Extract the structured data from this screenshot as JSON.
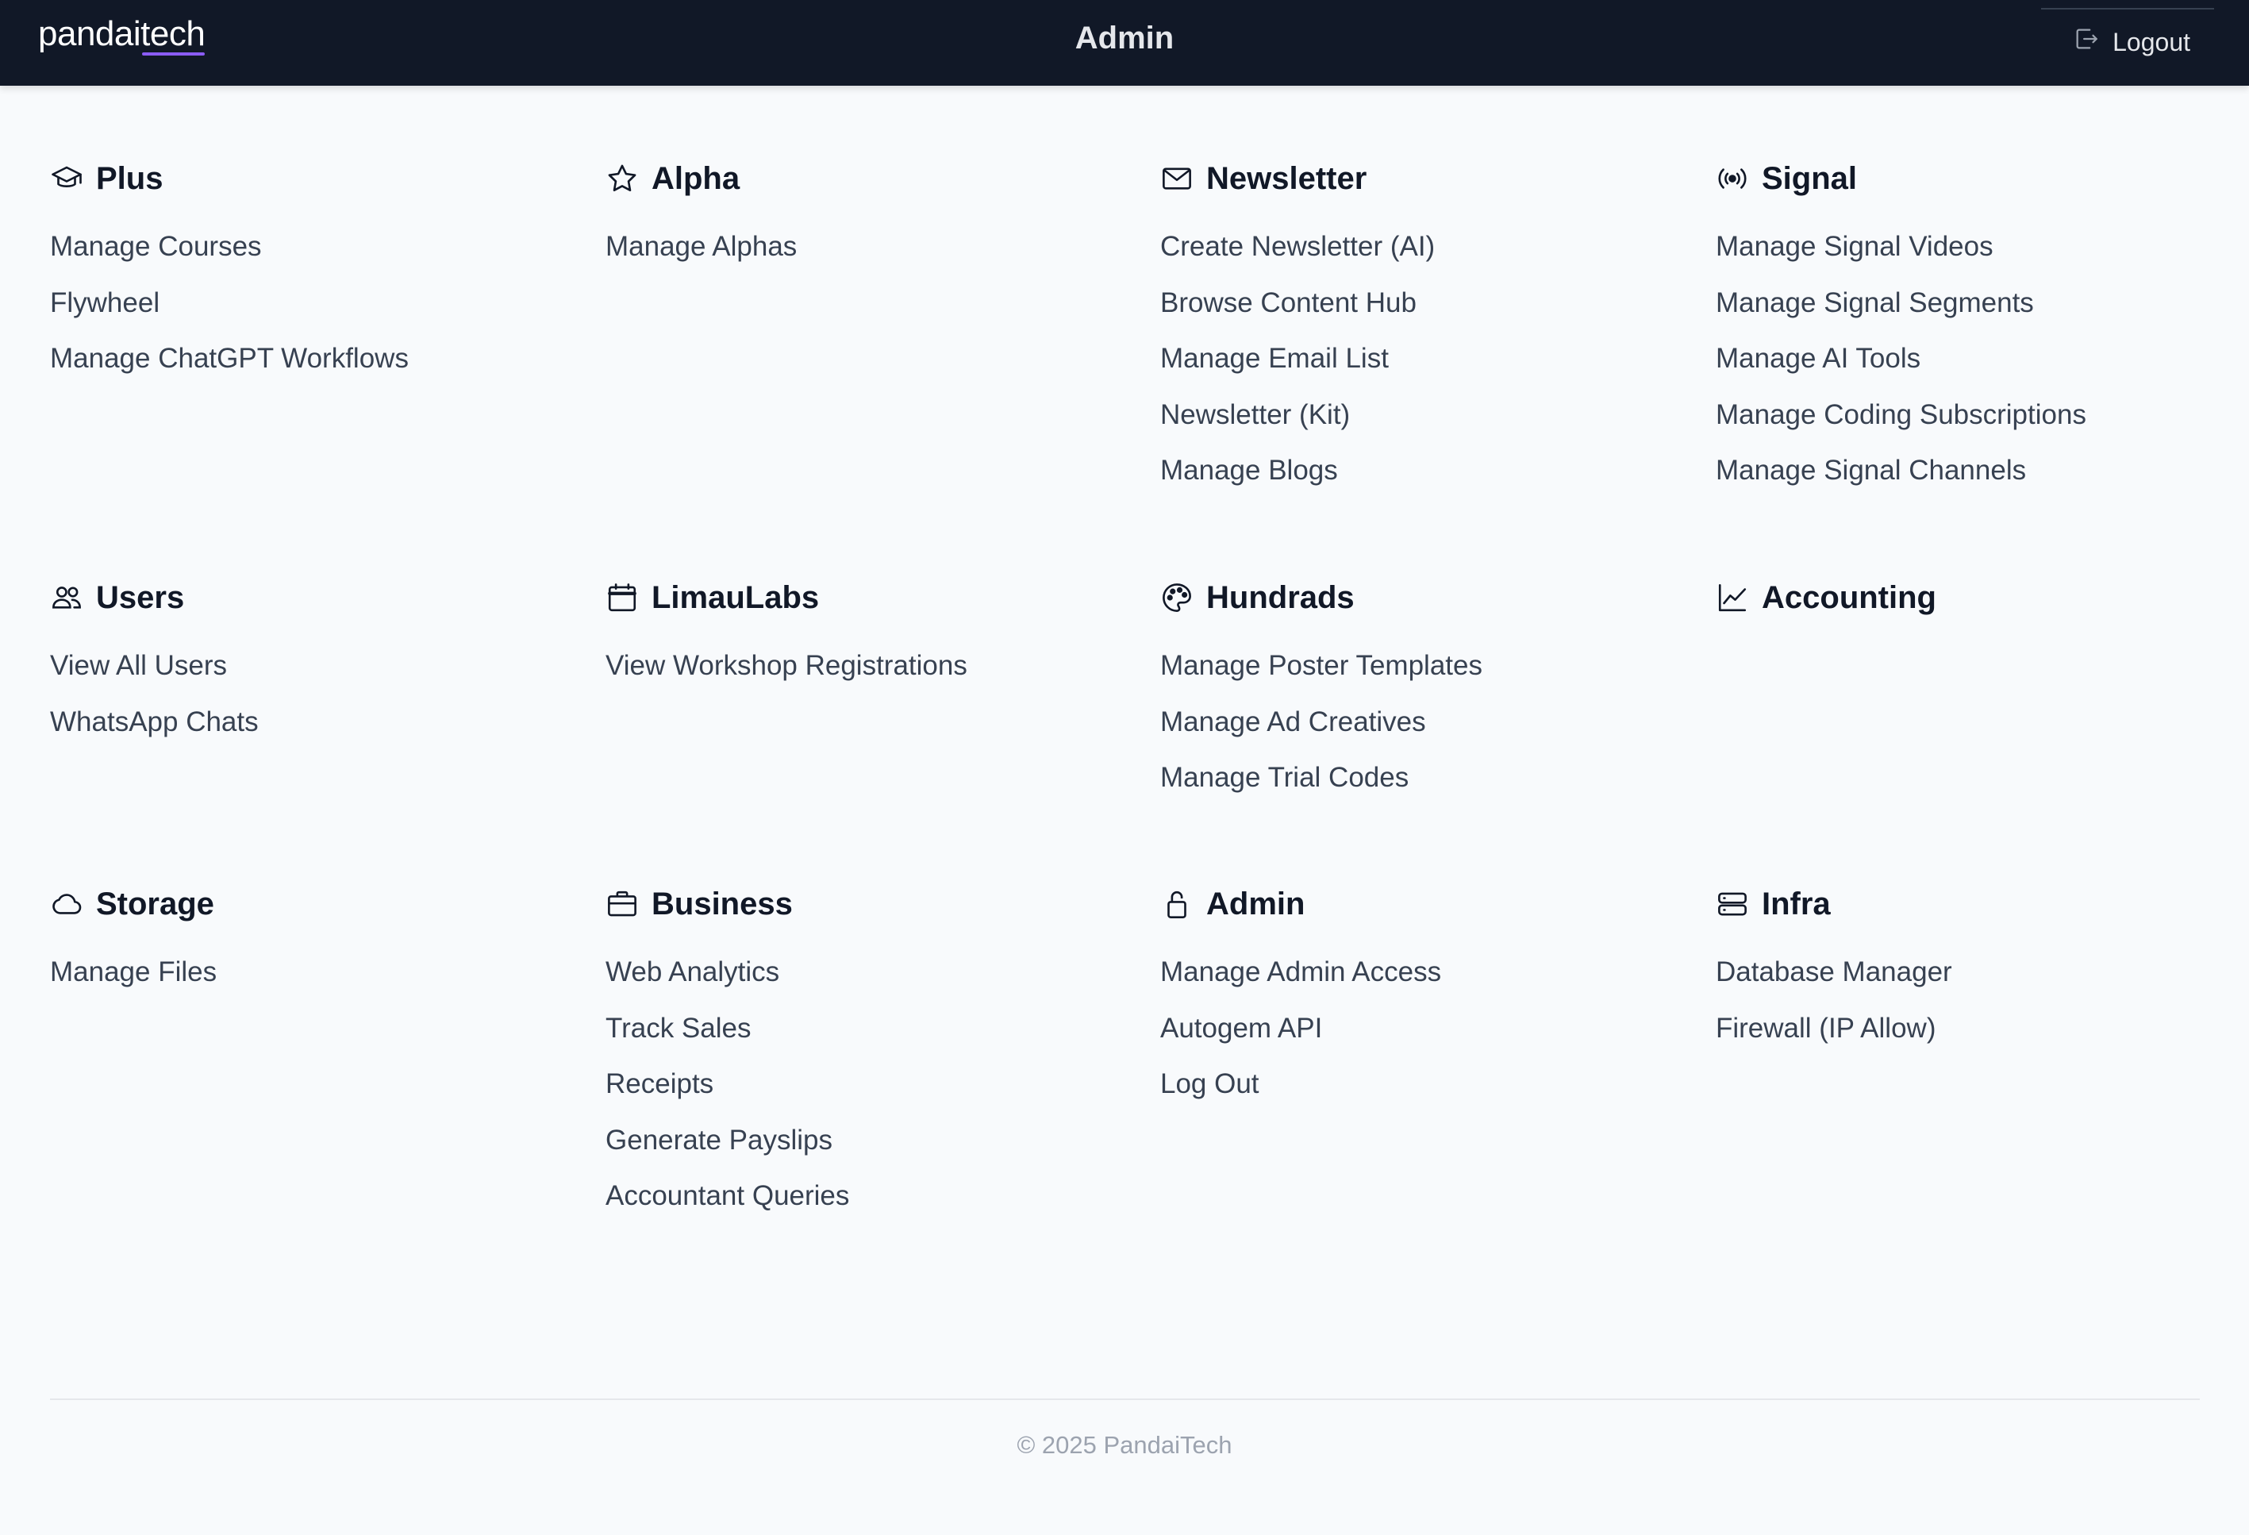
{
  "header": {
    "brand_part1": "pandai",
    "brand_part2": "tech",
    "title": "Admin",
    "logout_label": "Logout",
    "accent_color": "#8b5cf6",
    "background_color": "#111827"
  },
  "sections": [
    {
      "title": "Plus",
      "icon": "graduation-cap-icon",
      "links": [
        "Manage Courses",
        "Flywheel",
        "Manage ChatGPT Workflows"
      ]
    },
    {
      "title": "Alpha",
      "icon": "star-icon",
      "links": [
        "Manage Alphas"
      ]
    },
    {
      "title": "Newsletter",
      "icon": "envelope-icon",
      "links": [
        "Create Newsletter (AI)",
        "Browse Content Hub",
        "Manage Email List",
        "Newsletter (Kit)",
        "Manage Blogs"
      ]
    },
    {
      "title": "Signal",
      "icon": "broadcast-icon",
      "links": [
        "Manage Signal Videos",
        "Manage Signal Segments",
        "Manage AI Tools",
        "Manage Coding Subscriptions",
        "Manage Signal Channels"
      ]
    },
    {
      "title": "Users",
      "icon": "users-icon",
      "links": [
        "View All Users",
        "WhatsApp Chats"
      ]
    },
    {
      "title": "LimauLabs",
      "icon": "calendar-icon",
      "links": [
        "View Workshop Registrations"
      ]
    },
    {
      "title": "Hundrads",
      "icon": "palette-icon",
      "links": [
        "Manage Poster Templates",
        "Manage Ad Creatives",
        "Manage Trial Codes"
      ]
    },
    {
      "title": "Accounting",
      "icon": "chart-line-icon",
      "links": []
    },
    {
      "title": "Storage",
      "icon": "cloud-icon",
      "links": [
        "Manage Files"
      ]
    },
    {
      "title": "Business",
      "icon": "briefcase-icon",
      "links": [
        "Web Analytics",
        "Track Sales",
        "Receipts",
        "Generate Payslips",
        "Accountant Queries"
      ]
    },
    {
      "title": "Admin",
      "icon": "lock-icon",
      "links": [
        "Manage Admin Access",
        "Autogem API",
        "Log Out"
      ]
    },
    {
      "title": "Infra",
      "icon": "server-icon",
      "links": [
        "Database Manager",
        "Firewall (IP Allow)"
      ]
    }
  ],
  "footer": {
    "copyright": "© 2025 PandaiTech"
  }
}
